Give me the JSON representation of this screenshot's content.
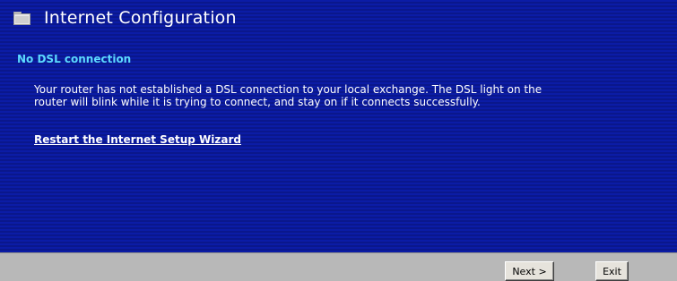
{
  "window": {
    "title": "Internet Configuration",
    "title_icon": "folder-icon"
  },
  "content": {
    "heading": "No DSL connection",
    "message_line1": "Your router has not established a DSL connection to your local exchange. The DSL light on the",
    "message_line2": "router will blink while it is trying to connect, and stay on if it connects successfully.",
    "restart_link": "Restart the Internet Setup Wizard"
  },
  "footer": {
    "next_label": "Next >",
    "exit_label": "Exit"
  },
  "colors": {
    "background": "#0a1a9c",
    "heading": "#5cd9ff",
    "text": "#ffffff",
    "footer": "#b8b8b8"
  }
}
